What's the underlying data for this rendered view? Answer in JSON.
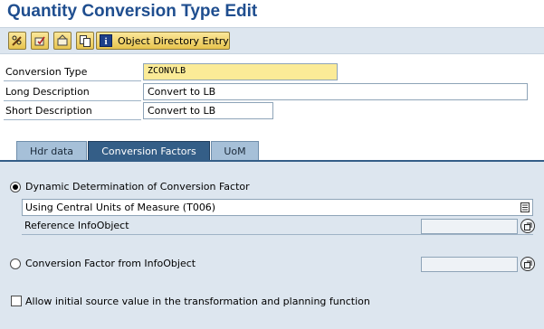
{
  "window": {
    "title": "Quantity Conversion Type Edit"
  },
  "toolbar": {
    "buttons": [
      {
        "icon": "pencil-glasses-icon"
      },
      {
        "icon": "activate-icon"
      },
      {
        "icon": "display-icon"
      },
      {
        "icon": "copy-icon"
      }
    ],
    "object_directory_label": "Object Directory Entry"
  },
  "header": {
    "conversion_type": {
      "label": "Conversion Type",
      "value": "ZCONVLB"
    },
    "long_description": {
      "label": "Long Description",
      "value": "Convert to LB"
    },
    "short_description": {
      "label": "Short Description",
      "value": "Convert to LB"
    }
  },
  "tabs": [
    {
      "label": "Hdr data",
      "active": false
    },
    {
      "label": "Conversion Factors",
      "active": true
    },
    {
      "label": "UoM",
      "active": false
    }
  ],
  "conversion_factors": {
    "dynamic_option": {
      "label": "Dynamic Determination of Conversion Factor",
      "selected": true
    },
    "dynamic_method": "Using Central Units of Measure (T006)",
    "reference_infoobject": {
      "label": "Reference InfoObject",
      "value": ""
    },
    "infoobject_option": {
      "label": "Conversion Factor from InfoObject",
      "selected": false,
      "value": ""
    },
    "allow_initial": {
      "label": "Allow initial source value in the transformation and planning function",
      "checked": false
    }
  },
  "colors": {
    "title": "#1f4e8f",
    "required_field": "#fbeb97",
    "panel_bg": "#dde6ef",
    "active_tab": "#345e87",
    "inactive_tab": "#a6c0d8"
  }
}
